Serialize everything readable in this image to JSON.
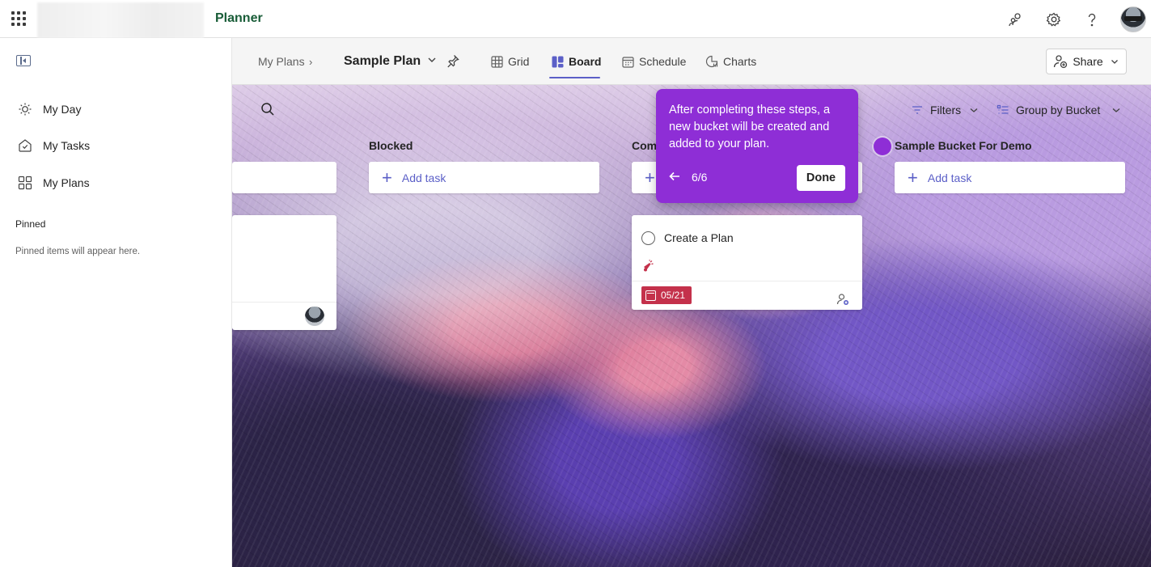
{
  "app": {
    "name": "Planner"
  },
  "topbar": {
    "icons": [
      "people-icon",
      "gear-icon",
      "help-icon"
    ]
  },
  "nav": {
    "items": [
      {
        "label": "My Day",
        "icon": "sun-icon"
      },
      {
        "label": "My Tasks",
        "icon": "tasks-icon"
      },
      {
        "label": "My Plans",
        "icon": "grid-icon"
      }
    ],
    "pinned_heading": "Pinned",
    "pinned_note": "Pinned items will appear here."
  },
  "header": {
    "breadcrumb": "My Plans",
    "plan_title": "Sample Plan",
    "tabs": [
      {
        "label": "Grid"
      },
      {
        "label": "Board",
        "active": true
      },
      {
        "label": "Schedule"
      },
      {
        "label": "Charts"
      }
    ],
    "share_label": "Share"
  },
  "toolbar": {
    "filters_label": "Filters",
    "group_label": "Group by Bucket"
  },
  "buckets": [
    {
      "title": "Blocked",
      "add_label": "Add task"
    },
    {
      "title": "Com",
      "add_label": "Add task"
    },
    {
      "title": "Sample Bucket For Demo",
      "add_label": "Add task"
    }
  ],
  "task": {
    "title": "Create a Plan",
    "due": "05/21",
    "priority": "Urgent"
  },
  "tooltip": {
    "text": "After completing these steps, a new bucket will be created and added to your plan.",
    "step": "6/6",
    "done_label": "Done"
  },
  "colors": {
    "accent": "#5b5fc7",
    "tooltip": "#8e2ed6",
    "due_overdue": "#c4314b",
    "brand": "#185c37"
  }
}
